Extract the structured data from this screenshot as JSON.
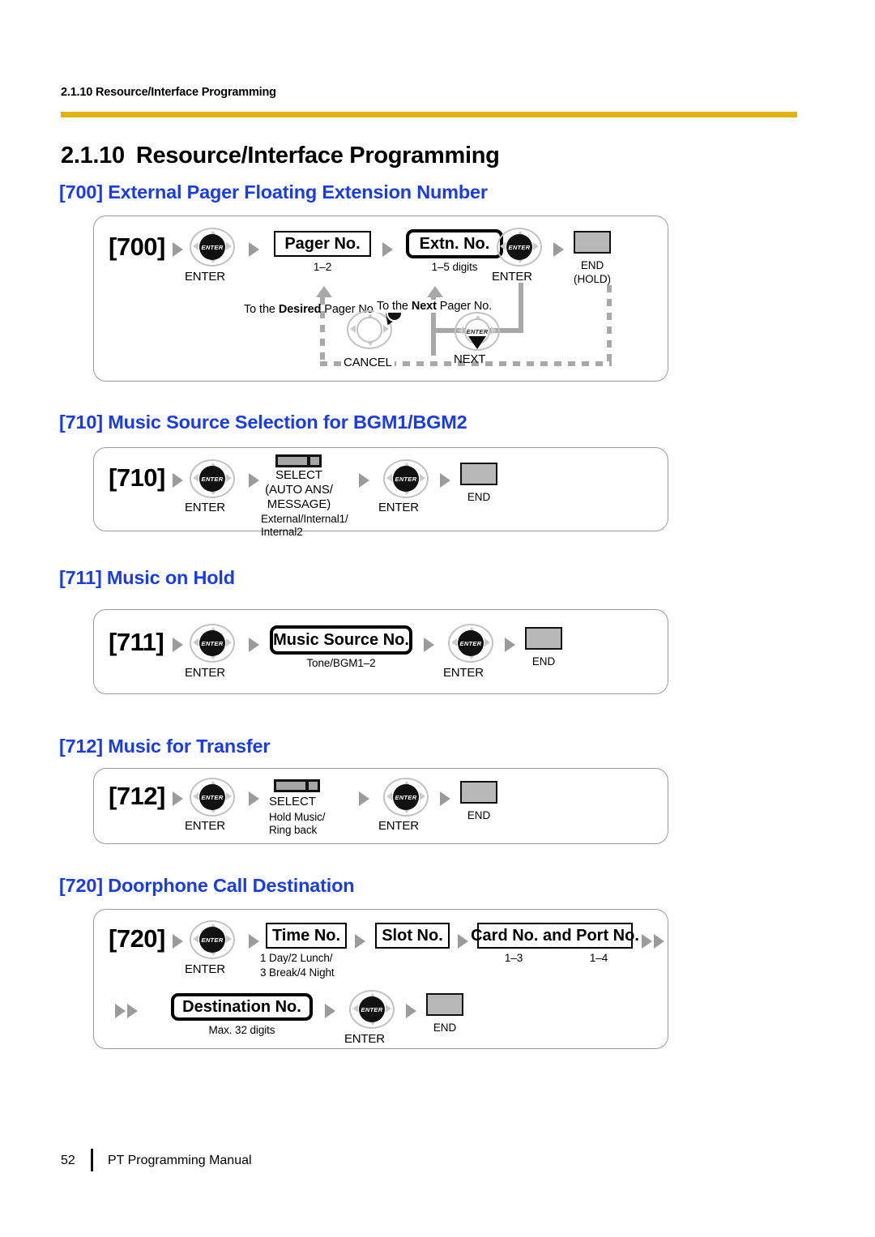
{
  "header": {
    "running_head": "2.1.10 Resource/Interface Programming",
    "rule_color": "#E0B40C"
  },
  "chapter": {
    "number": "2.1.10",
    "title": "Resource/Interface Programming",
    "heading_color": "#1A3CE8"
  },
  "footer": {
    "page_number": "52",
    "text": "PT Programming Manual"
  },
  "sections": [
    {
      "id": "700",
      "heading": "[700] External Pager Floating Extension Number",
      "code": "[700]",
      "steps": {
        "enter1_label": "ENTER",
        "enter1_key": "ENTER",
        "pager_box": "Pager No.",
        "pager_sub": "1–2",
        "extn_box": "Extn. No.",
        "extn_sub": "1–5 digits",
        "enter2_label": "ENTER",
        "enter2_key": "ENTER",
        "end_label_1": "END",
        "end_label_2": "(HOLD)"
      },
      "loops": {
        "desired_label_bold": "Desired",
        "desired_label_pre": "To the ",
        "desired_label_post": " Pager No.",
        "next_label_pre": "To the ",
        "next_label_bold": "Next",
        "next_label_post": " Pager No.",
        "cancel_label": "CANCEL",
        "next_label": "NEXT",
        "next_key": "ENTER"
      }
    },
    {
      "id": "710",
      "heading": "[710] Music Source Selection for BGM1/BGM2",
      "code": "[710]",
      "steps": {
        "enter1_label": "ENTER",
        "enter1_key": "ENTER",
        "select_label_line1": "SELECT",
        "select_label_line2": "(AUTO ANS/",
        "select_label_line3": "MESSAGE)",
        "select_sub_line1": "External/Internal1/",
        "select_sub_line2": "Internal2",
        "enter2_label": "ENTER",
        "enter2_key": "ENTER",
        "end_label": "END"
      }
    },
    {
      "id": "711",
      "heading": "[711] Music on Hold",
      "code": "[711]",
      "steps": {
        "enter1_label": "ENTER",
        "enter1_key": "ENTER",
        "music_box": "Music Source No.",
        "music_sub": "Tone/BGM1–2",
        "enter2_label": "ENTER",
        "enter2_key": "ENTER",
        "end_label": "END"
      }
    },
    {
      "id": "712",
      "heading": "[712] Music for Transfer",
      "code": "[712]",
      "steps": {
        "enter1_label": "ENTER",
        "enter1_key": "ENTER",
        "select_label": "SELECT",
        "select_sub_line1": "Hold Music/",
        "select_sub_line2": "Ring back",
        "enter2_label": "ENTER",
        "enter2_key": "ENTER",
        "end_label": "END"
      }
    },
    {
      "id": "720",
      "heading": "[720] Doorphone Call Destination",
      "code": "[720]",
      "steps": {
        "enter1_label": "ENTER",
        "enter1_key": "ENTER",
        "time_box": "Time No.",
        "time_sub_line1": "1 Day/2 Lunch/",
        "time_sub_line2": "3 Break/4 Night",
        "slot_box": "Slot No.",
        "card_box": "Card No. and Port No.",
        "card_sub_1": "1–3",
        "card_sub_2": "1–4",
        "dest_box": "Destination No.",
        "dest_sub": "Max. 32 digits",
        "enter2_label": "ENTER",
        "enter2_key": "ENTER",
        "end_label": "END"
      }
    }
  ]
}
